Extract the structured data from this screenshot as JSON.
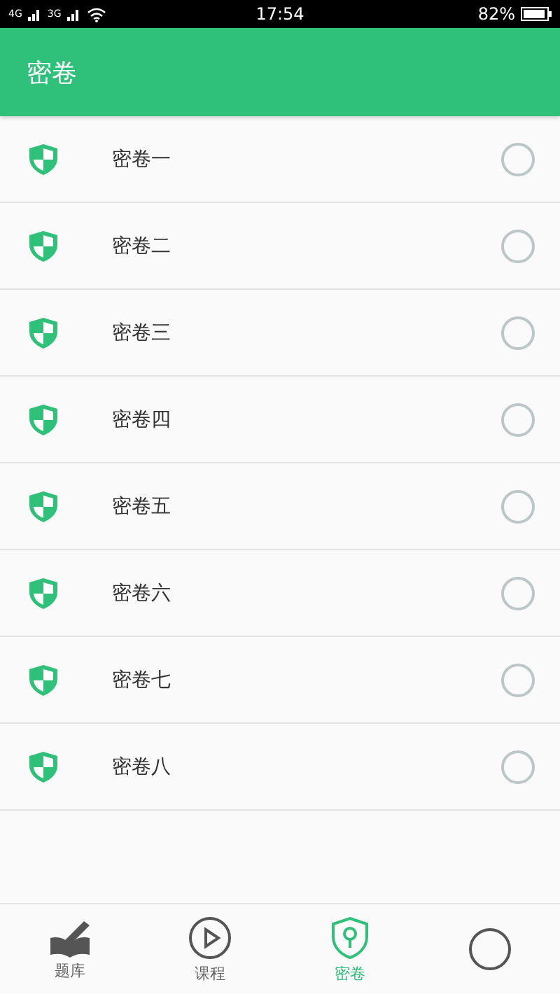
{
  "status_bar": {
    "network_1": "4G",
    "network_2": "3G",
    "time": "17:54",
    "battery": "82%"
  },
  "header": {
    "title": "密卷"
  },
  "items": [
    {
      "label": "密卷一",
      "selected": false
    },
    {
      "label": "密卷二",
      "selected": false
    },
    {
      "label": "密卷三",
      "selected": false
    },
    {
      "label": "密卷四",
      "selected": false
    },
    {
      "label": "密卷五",
      "selected": false
    },
    {
      "label": "密卷六",
      "selected": false
    },
    {
      "label": "密卷七",
      "selected": false
    },
    {
      "label": "密卷八",
      "selected": false
    }
  ],
  "nav": [
    {
      "kind": "book",
      "label": "题库",
      "selected": false
    },
    {
      "kind": "play",
      "label": "课程",
      "selected": false
    },
    {
      "kind": "shield",
      "label": "密卷",
      "selected": true
    },
    {
      "kind": "circle",
      "selected": false
    }
  ]
}
